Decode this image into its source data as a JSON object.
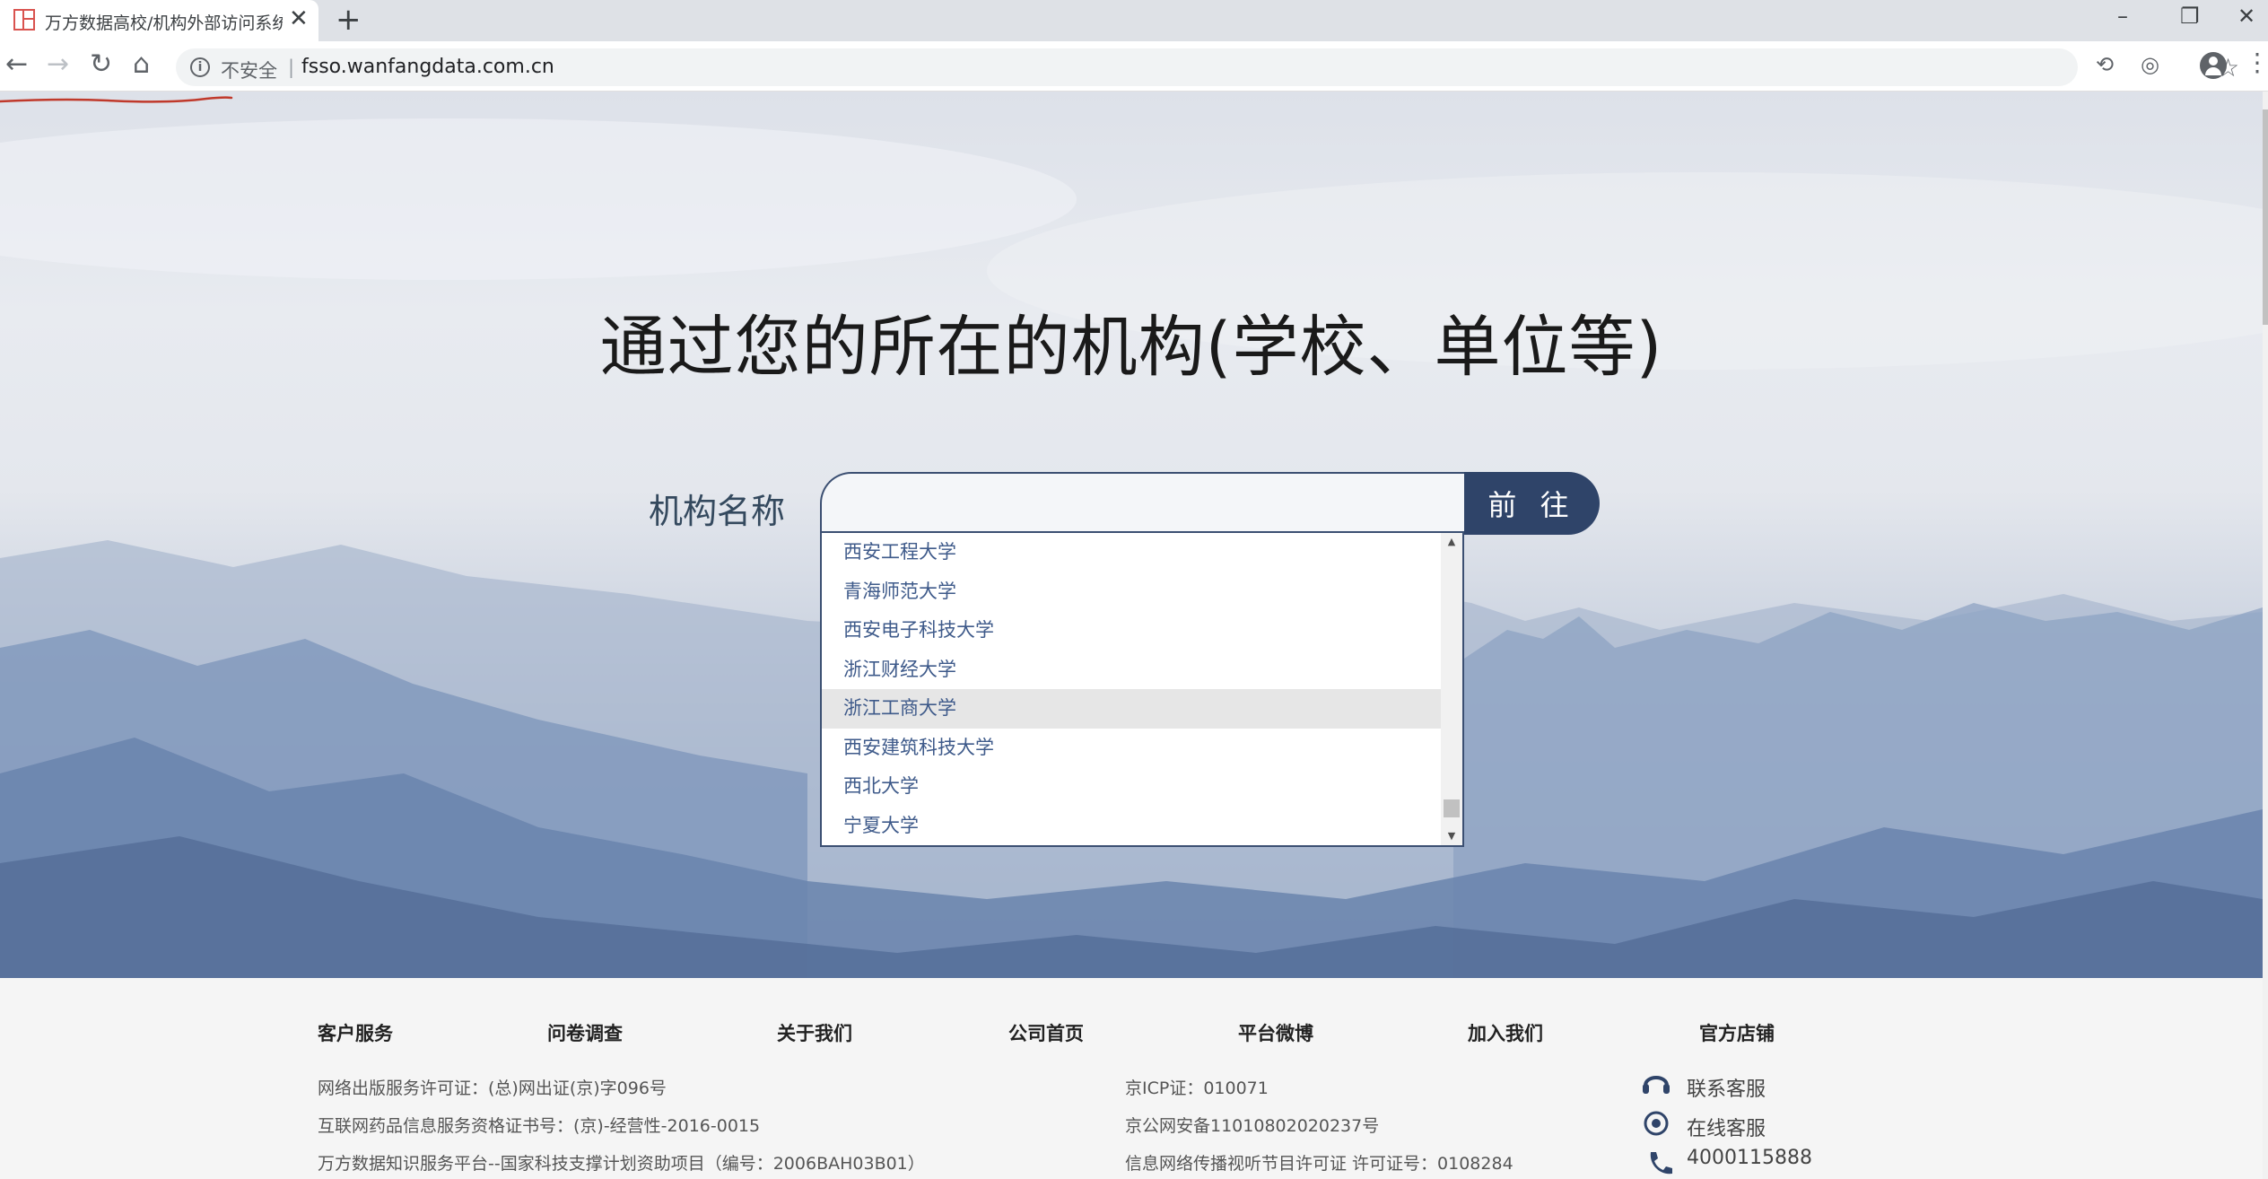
{
  "browser": {
    "tab_title": "万方数据高校/机构外部访问系统",
    "close_glyph": "✕",
    "new_tab_glyph": "+",
    "address": {
      "security_label": "不安全",
      "separator": "|",
      "url": "fsso.wanfangdata.com.cn"
    },
    "window_controls": [
      "–",
      "❐",
      "✕"
    ]
  },
  "hero": {
    "title": "通过您的所在的机构(学校、单位等)",
    "field_label": "机构名称",
    "search_value": "",
    "go_button_label": "前 往"
  },
  "dropdown": {
    "items": [
      "西安工程大学",
      "青海师范大学",
      "西安电子科技大学",
      "浙江财经大学",
      "浙江工商大学",
      "西安建筑科技大学",
      "西北大学",
      "宁夏大学"
    ],
    "hovered_item": "浙江工商大学"
  },
  "footer": {
    "nav": [
      "客户服务",
      "问卷调查",
      "关于我们",
      "公司首页",
      "平台微博",
      "加入我们",
      "官方店铺"
    ],
    "left_lines": [
      "网络出版服务许可证：(总)网出证(京)字096号",
      "互联网药品信息服务资格证书号：(京)-经营性-2016-0015",
      "万方数据知识服务平台--国家科技支撑计划资助项目（编号：2006BAH03B01）"
    ],
    "mid_lines": [
      "京ICP证：010071",
      "京公网安备11010802020237号",
      "信息网络传播视听节目许可证 许可证号：0108284"
    ],
    "contacts": [
      "联系客服",
      "在线客服",
      "4000115888"
    ]
  },
  "colors": {
    "accent": "#2f4469",
    "link": "#3e5a8a",
    "annotation": "#c0392b"
  }
}
